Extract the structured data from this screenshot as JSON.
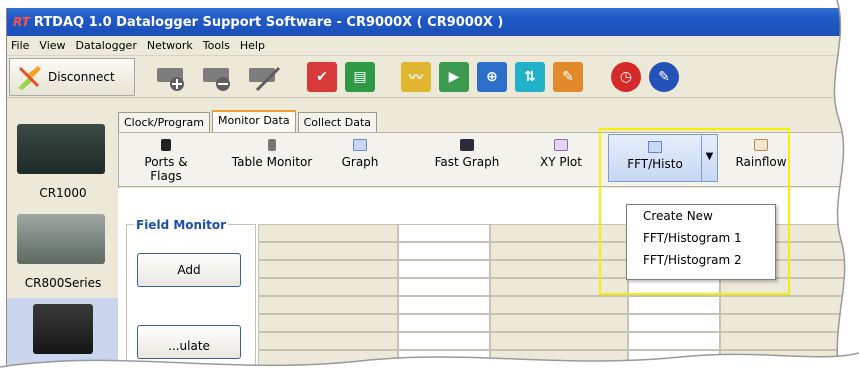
{
  "window": {
    "title": "RTDAQ 1.0 Datalogger Support Software - CR9000X ( CR9000X )",
    "logo_text": "RT"
  },
  "menubar": {
    "items": [
      "File",
      "View",
      "Datalogger",
      "Network",
      "Tools",
      "Help"
    ]
  },
  "toolbar": {
    "disconnect_label": "Disconnect"
  },
  "sidebar": {
    "stations": [
      {
        "label": "CR1000"
      },
      {
        "label": "CR800Series"
      },
      {
        "label": ""
      }
    ]
  },
  "tabs": [
    {
      "label": "Clock/Program"
    },
    {
      "label": "Monitor Data"
    },
    {
      "label": "Collect Data"
    }
  ],
  "monitor_bar": {
    "items": [
      {
        "label": "Ports & Flags",
        "icon": "flags-icon"
      },
      {
        "label": "Table Monitor",
        "icon": "table-icon"
      },
      {
        "label": "Graph",
        "icon": "graph-icon"
      },
      {
        "label": "Fast Graph",
        "icon": "fast-graph-icon"
      },
      {
        "label": "XY Plot",
        "icon": "xy-plot-icon"
      },
      {
        "label": "FFT/Histo",
        "icon": "fft-icon"
      },
      {
        "label": "Rainflow",
        "icon": "rainflow-icon"
      }
    ]
  },
  "dropdown": {
    "items": [
      "Create New",
      "FFT/Histogram 1",
      "FFT/Histogram 2"
    ]
  },
  "field_monitor": {
    "title": "Field Monitor",
    "add_label": "Add",
    "second_button_label": "...ulate"
  },
  "colors": {
    "title_bar": "#1f58c6",
    "highlight": "#f4f000",
    "accent_tab": "#f0a030"
  }
}
